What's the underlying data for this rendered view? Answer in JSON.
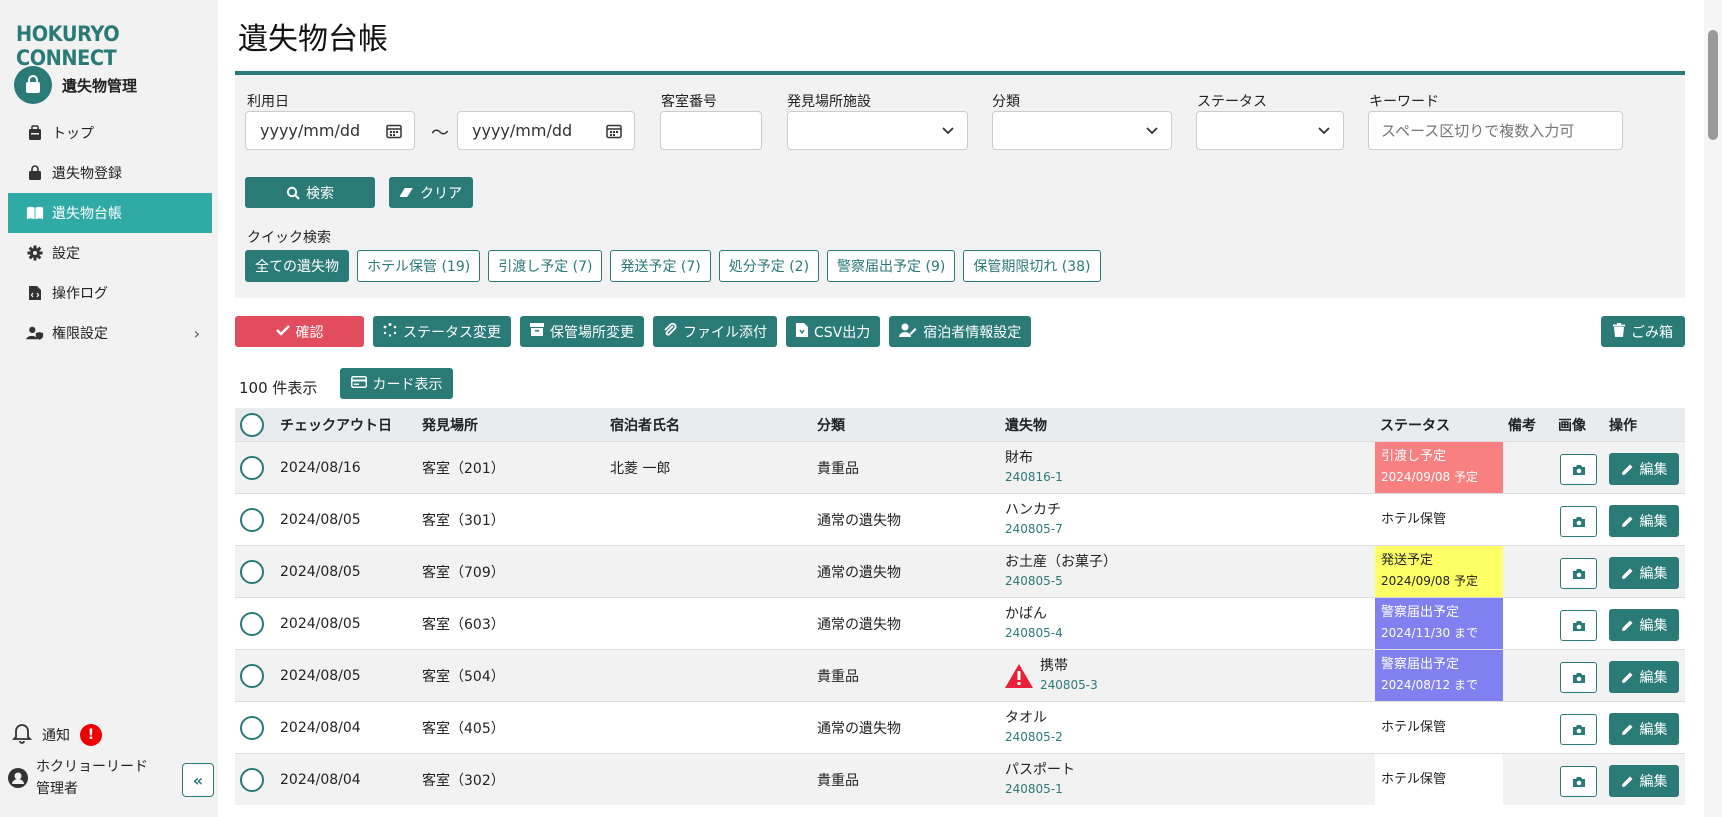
{
  "sidebar": {
    "brand": "HOKURYO CONNECT",
    "app_title": "遺失物管理",
    "items": [
      {
        "label": "トップ",
        "icon": "briefcase-icon"
      },
      {
        "label": "遺失物登録",
        "icon": "bag-icon"
      },
      {
        "label": "遺失物台帳",
        "icon": "book-icon",
        "active": true
      },
      {
        "label": "設定",
        "icon": "gear-icon"
      },
      {
        "label": "操作ログ",
        "icon": "file-code-icon"
      },
      {
        "label": "権限設定",
        "icon": "user-shield-icon"
      }
    ],
    "notify_label": "通知",
    "notify_badge": "!",
    "user_name_line1": "ホクリョーリード",
    "user_name_line2": "管理者",
    "collapse_label": "«"
  },
  "page": {
    "title": "遺失物台帳"
  },
  "filters": {
    "date_label": "利用日",
    "date_from_placeholder": "yyyy/mm/dd",
    "date_to_placeholder": "yyyy/mm/dd",
    "tilde": "～",
    "room_label": "客室番号",
    "facility_label": "発見場所施設",
    "category_label": "分類",
    "status_label": "ステータス",
    "keyword_label": "キーワード",
    "keyword_placeholder": "スペース区切りで複数入力可",
    "search_label": "検索",
    "clear_label": "クリア",
    "quick_label": "クイック検索",
    "chips": [
      "全ての遺失物",
      "ホテル保管 (19)",
      "引渡し予定 (7)",
      "発送予定 (7)",
      "処分予定 (2)",
      "警察届出予定 (9)",
      "保管期限切れ (38)"
    ]
  },
  "actions": {
    "confirm": "確認",
    "status_change": "ステータス変更",
    "storage_change": "保管場所変更",
    "file_attach": "ファイル添付",
    "csv": "CSV出力",
    "guest_info": "宿泊者情報設定",
    "trash": "ごみ箱"
  },
  "list": {
    "count_label": "100 件表示",
    "card_view_label": "カード表示"
  },
  "table": {
    "headers": {
      "checkout": "チェックアウト日",
      "place": "発見場所",
      "guest": "宿泊者氏名",
      "category": "分類",
      "item": "遺失物",
      "status": "ステータス",
      "note": "備考",
      "image": "画像",
      "ops": "操作"
    },
    "edit_label": "編集",
    "rows": [
      {
        "date": "2024/08/16",
        "place": "客室（201）",
        "guest": "北菱 一郎",
        "category": "貴重品",
        "item": "財布",
        "item_id": "240816-1",
        "status": "引渡し予定",
        "status_date": "2024/09/08 予定",
        "status_color": "#f98080",
        "status_text_color": "#fff",
        "warn": false
      },
      {
        "date": "2024/08/05",
        "place": "客室（301）",
        "guest": "",
        "category": "通常の遺失物",
        "item": "ハンカチ",
        "item_id": "240805-7",
        "status": "ホテル保管",
        "status_date": "",
        "status_color": "",
        "status_text_color": "#222",
        "warn": false
      },
      {
        "date": "2024/08/05",
        "place": "客室（709）",
        "guest": "",
        "category": "通常の遺失物",
        "item": "お土産（お菓子）",
        "item_id": "240805-5",
        "status": "発送予定",
        "status_date": "2024/09/08 予定",
        "status_color": "#ffff66",
        "status_text_color": "#222",
        "warn": false
      },
      {
        "date": "2024/08/05",
        "place": "客室（603）",
        "guest": "",
        "category": "通常の遺失物",
        "item": "かばん",
        "item_id": "240805-4",
        "status": "警察届出予定",
        "status_date": "2024/11/30 まで",
        "status_color": "#8080f0",
        "status_text_color": "#fff",
        "warn": false
      },
      {
        "date": "2024/08/05",
        "place": "客室（504）",
        "guest": "",
        "category": "貴重品",
        "item": "携帯",
        "item_id": "240805-3",
        "status": "警察届出予定",
        "status_date": "2024/08/12 まで",
        "status_color": "#8080f0",
        "status_text_color": "#fff",
        "warn": true
      },
      {
        "date": "2024/08/04",
        "place": "客室（405）",
        "guest": "",
        "category": "通常の遺失物",
        "item": "タオル",
        "item_id": "240805-2",
        "status": "ホテル保管",
        "status_date": "",
        "status_color": "",
        "status_text_color": "#222",
        "warn": false
      },
      {
        "date": "2024/08/04",
        "place": "客室（302）",
        "guest": "",
        "category": "貴重品",
        "item": "パスポート",
        "item_id": "240805-1",
        "status": "ホテル保管",
        "status_date": "",
        "status_color": "#fff",
        "status_text_color": "#222",
        "warn": false
      }
    ]
  },
  "colors": {
    "accent": "#2a7a78",
    "active_nav": "#30aaa5",
    "danger": "#e14d5e"
  }
}
